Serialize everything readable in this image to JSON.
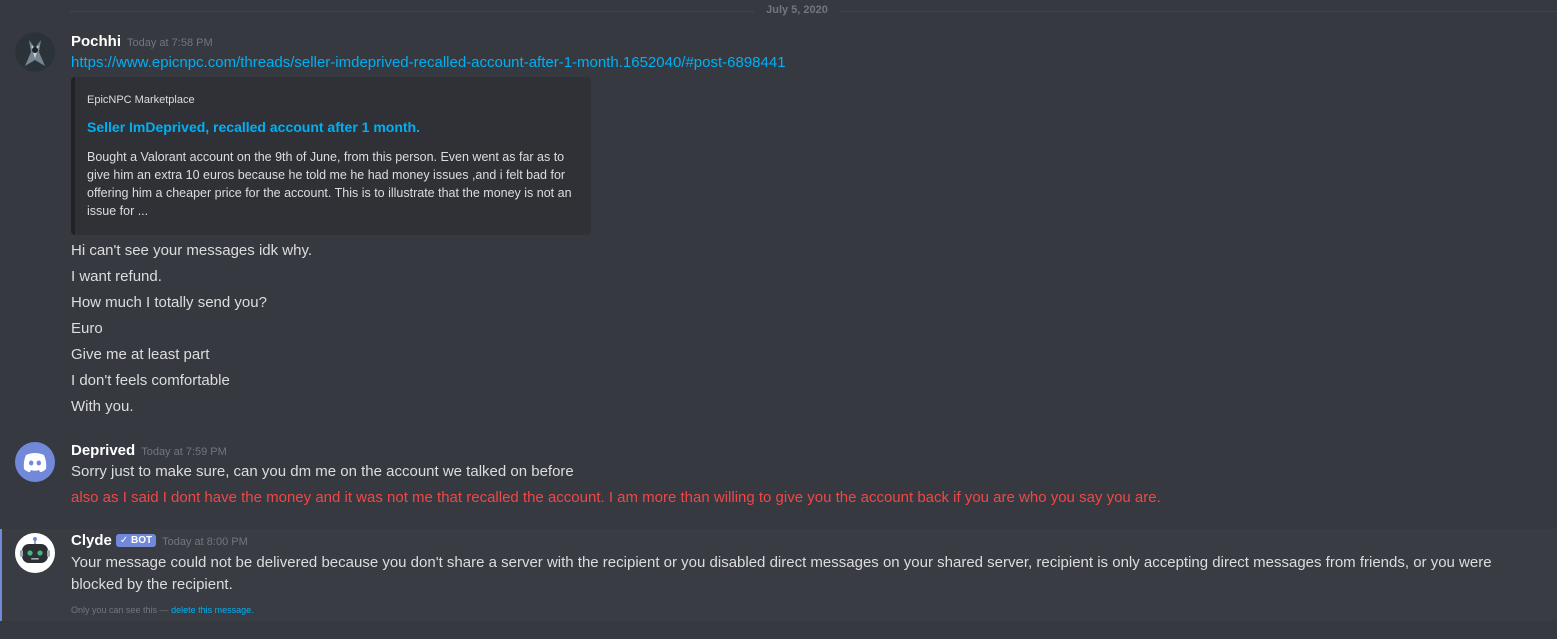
{
  "date_divider": "July 5, 2020",
  "messages": [
    {
      "username": "Pochhi",
      "timestamp": "Today at 7:58 PM",
      "link": "https://www.epicnpc.com/threads/seller-imdeprived-recalled-account-after-1-month.1652040/#post-6898441",
      "embed": {
        "provider": "EpicNPC Marketplace",
        "title": "Seller ImDeprived, recalled account after 1 month.",
        "description": "Bought a Valorant account on the 9th of June, from this person. Even went as far as to give him an extra 10 euros because he told me he had money issues ,and i felt bad for offering him a cheaper price for the account. This is to illustrate that the money is not an issue for ..."
      },
      "lines": [
        "Hi can't see your messages idk why.",
        "I want refund.",
        "How much I totally send you?",
        "Euro",
        "Give me at least part",
        "I don't feels comfortable",
        "With you."
      ]
    },
    {
      "username": "Deprived",
      "timestamp": "Today at 7:59 PM",
      "lines": [
        "Sorry just to make sure, can you dm me on the account we talked on before",
        "also as I said I dont have the money and it was not me that recalled the account. I am more than willing to give you the account back if you are who you say you are."
      ]
    },
    {
      "username": "Clyde",
      "bot_tag": "BOT",
      "timestamp": "Today at 8:00 PM",
      "text": "Your message could not be delivered because you don't share a server with the recipient or you disabled direct messages on your shared server, recipient is only accepting direct messages from friends, or you were blocked by the recipient.",
      "ephemeral_note": "Only you can see this —",
      "ephemeral_action": "delete this message."
    }
  ],
  "colors": {
    "background": "#36393f",
    "link": "#00b0f4",
    "error_text": "#f04747",
    "blurple": "#7289da"
  }
}
